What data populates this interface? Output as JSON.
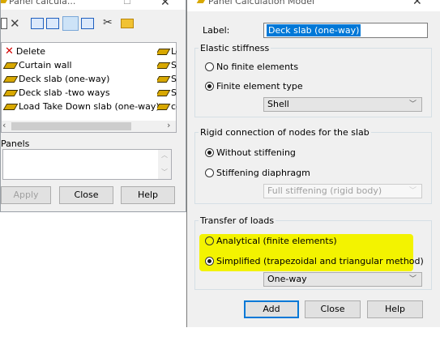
{
  "left_window": {
    "title": "Panel calcula...",
    "list_items": [
      {
        "label": "Delete",
        "icon": "red-x-icon"
      },
      {
        "label": "Curtain wall",
        "icon": "slab-icon"
      },
      {
        "label": "Deck slab (one-way)",
        "icon": "slab-icon"
      },
      {
        "label": "Deck slab -two ways",
        "icon": "slab-icon"
      },
      {
        "label": "Load Take Down slab (one-way)",
        "icon": "slab-icon"
      }
    ],
    "list_col2": [
      "Lo",
      "Sl",
      "Sl",
      "Sl",
      "co"
    ],
    "panels_label": "Panels",
    "buttons": {
      "apply": "Apply",
      "close": "Close",
      "help": "Help"
    }
  },
  "dialog": {
    "title": "Panel Calculation Model",
    "label_caption": "Label:",
    "label_value": "Deck slab (one-way)",
    "elastic": {
      "title": "Elastic stiffness",
      "no_fe": "No finite elements",
      "fe_type": "Finite element type",
      "fe_type_value": "Shell"
    },
    "rigid": {
      "title": "Rigid connection of nodes for the slab",
      "without": "Without stiffening",
      "diaphragm": "Stiffening diaphragm",
      "diaphragm_value": "Full stiffening (rigid body)"
    },
    "transfer": {
      "title": "Transfer of loads",
      "analytical": "Analytical (finite elements)",
      "simplified": "Simplified (trapezoidal and triangular method)",
      "direction_value": "One-way"
    },
    "buttons": {
      "add": "Add",
      "close": "Close",
      "help": "Help"
    }
  }
}
